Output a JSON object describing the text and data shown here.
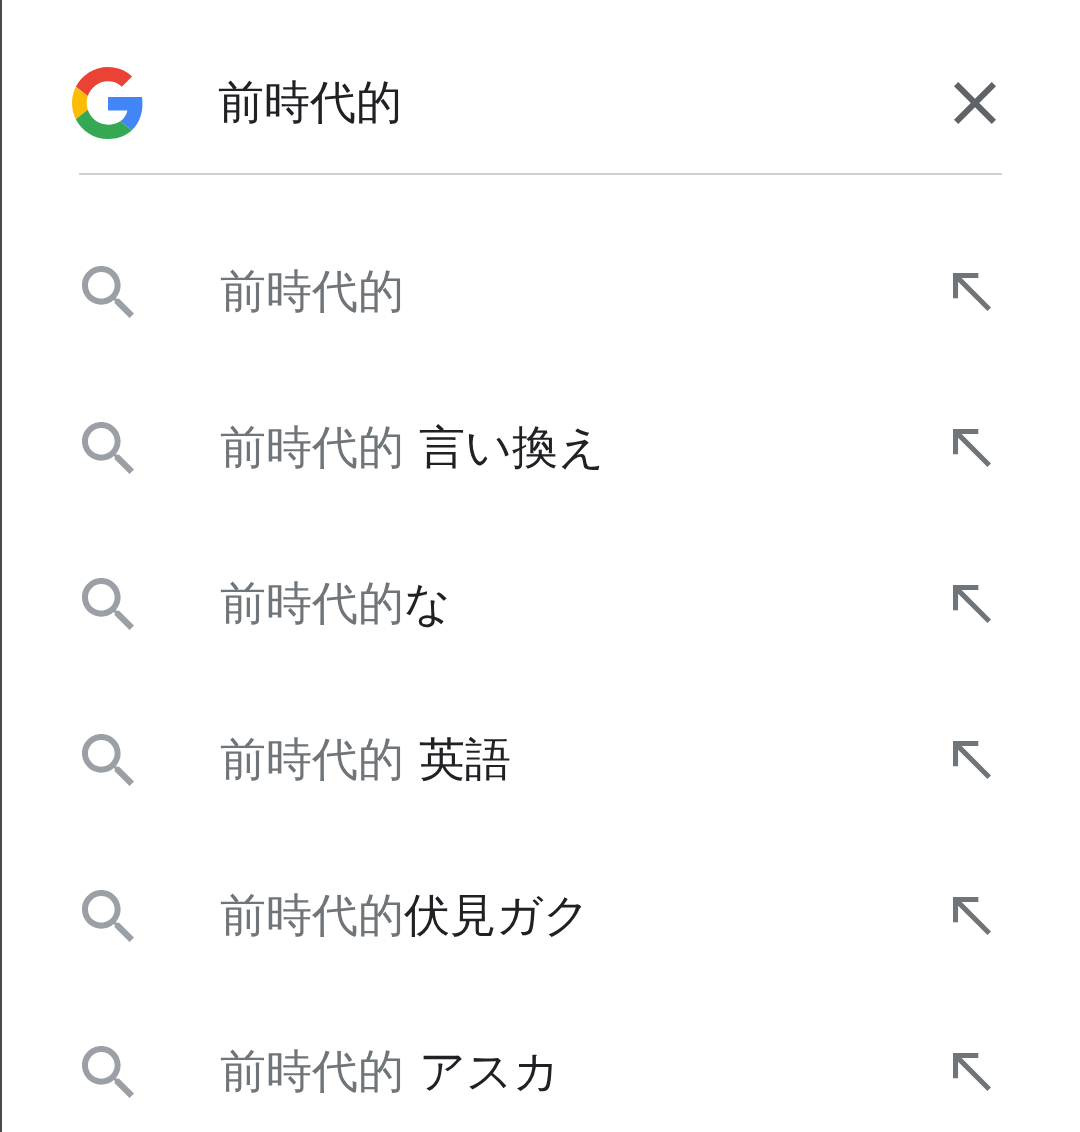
{
  "search_bar": {
    "query": "前時代的"
  },
  "suggestions": [
    {
      "typed": "前時代的"
    },
    {
      "typed": "前時代的",
      "completion": " 言い換え"
    },
    {
      "typed": "前時代的",
      "completion": "な"
    },
    {
      "typed": "前時代的",
      "completion": " 英語"
    },
    {
      "typed": "前時代的",
      "completion": "伏見ガク"
    },
    {
      "typed": "前時代的",
      "completion": " アスカ"
    }
  ]
}
